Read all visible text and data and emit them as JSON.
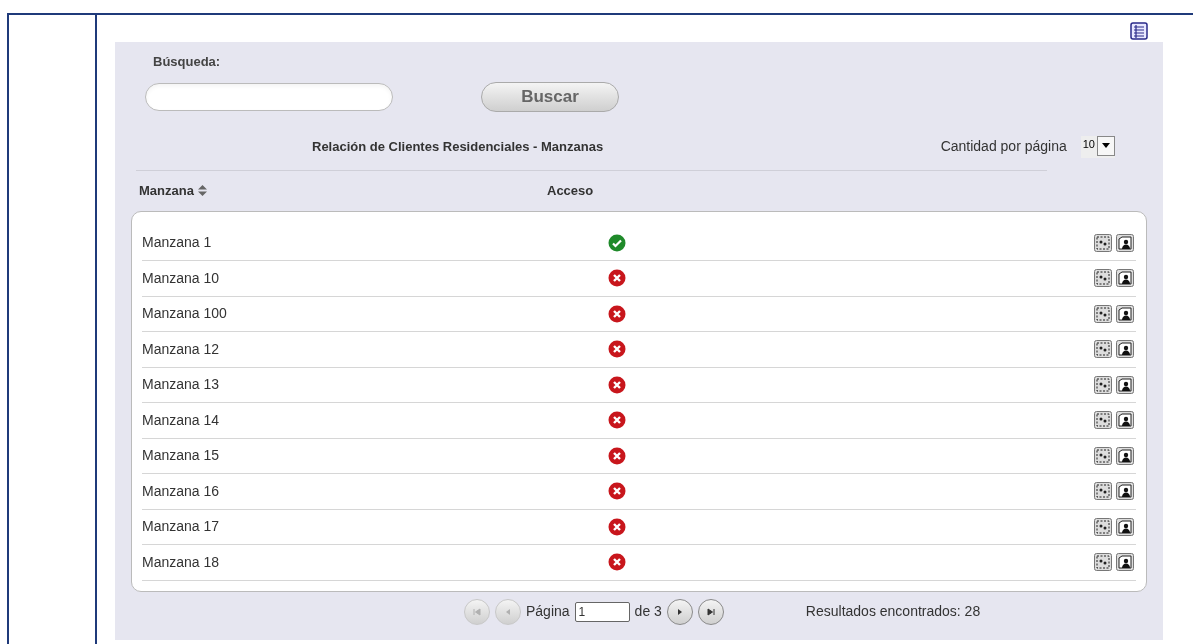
{
  "search": {
    "label": "Búsqueda:",
    "button": "Buscar"
  },
  "table": {
    "title": "Relación de Clientes Residenciales - Manzanas",
    "page_size_label": "Cantidad por página",
    "page_size": "10",
    "columns": [
      {
        "label": "Manzana",
        "sortable": true
      },
      {
        "label": "Acceso",
        "sortable": false
      }
    ],
    "rows": [
      {
        "name": "Manzana 1",
        "access": true
      },
      {
        "name": "Manzana 10",
        "access": false
      },
      {
        "name": "Manzana 100",
        "access": false
      },
      {
        "name": "Manzana 12",
        "access": false
      },
      {
        "name": "Manzana 13",
        "access": false
      },
      {
        "name": "Manzana 14",
        "access": false
      },
      {
        "name": "Manzana 15",
        "access": false
      },
      {
        "name": "Manzana 16",
        "access": false
      },
      {
        "name": "Manzana 17",
        "access": false
      },
      {
        "name": "Manzana 18",
        "access": false
      }
    ]
  },
  "pagination": {
    "page_label": "Página",
    "page": "1",
    "of_label": "de 3",
    "first_disabled": true,
    "prev_disabled": true,
    "next_disabled": false,
    "last_disabled": false,
    "results": "Resultados encontrados: 28"
  }
}
